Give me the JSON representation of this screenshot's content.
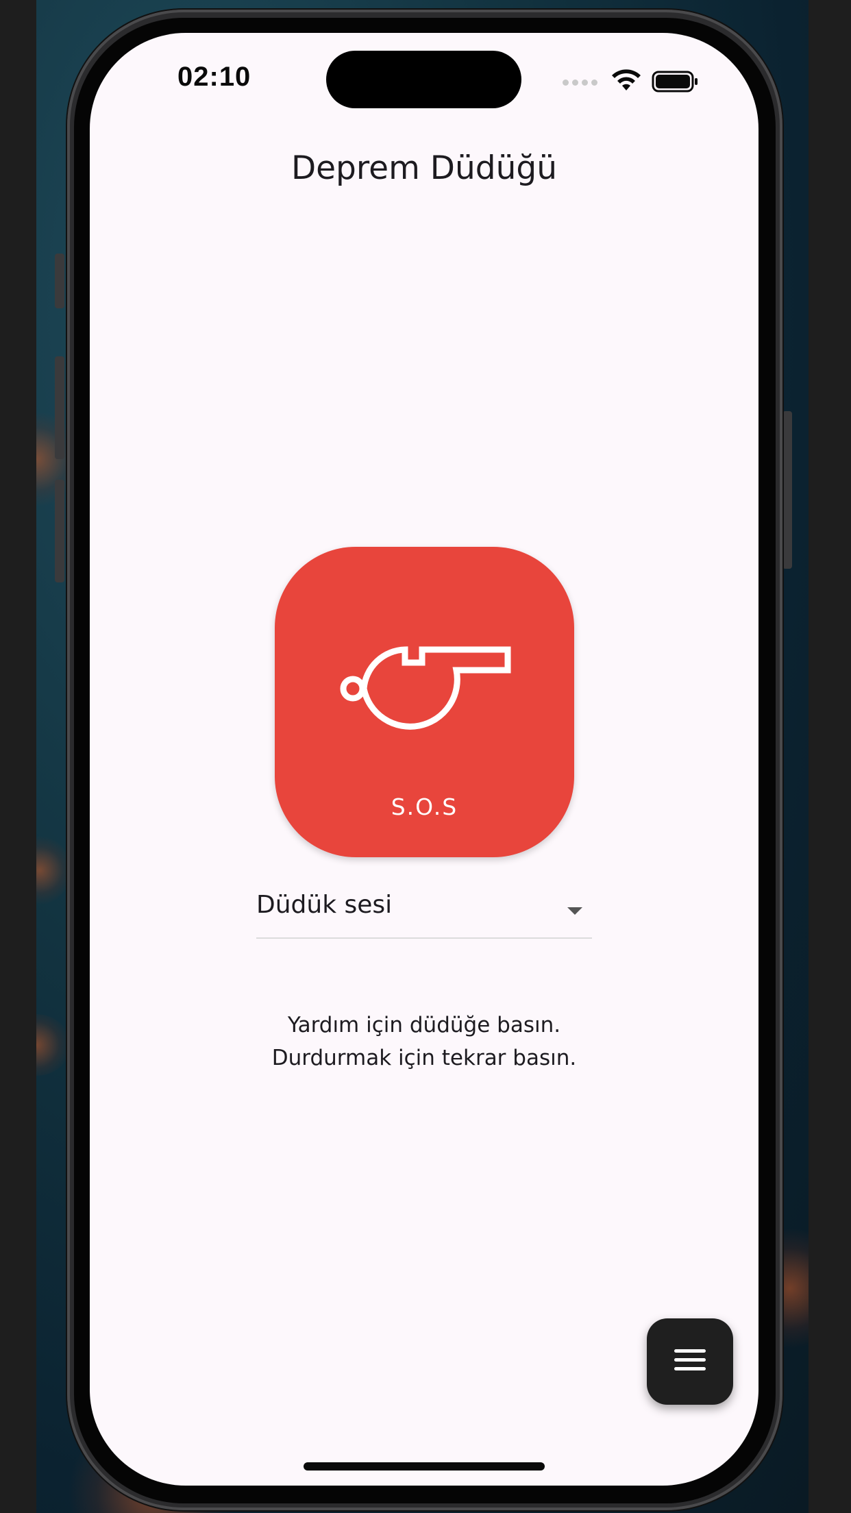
{
  "status_bar": {
    "time": "02:10",
    "signal_icon": "cellular-signal-icon",
    "wifi_icon": "wifi-icon",
    "battery_icon": "battery-icon"
  },
  "app": {
    "title": "Deprem Düdüğü"
  },
  "sos_button": {
    "icon": "whistle-icon",
    "label": "S.O.S",
    "color": "#e8453c"
  },
  "sound_dropdown": {
    "selected_value": "Düdük sesi",
    "icon": "chevron-down-icon"
  },
  "help_text": {
    "line1": "Yardım için düdüğe basın.",
    "line2": "Durdurmak için tekrar basın."
  },
  "fab": {
    "icon": "menu-icon"
  }
}
